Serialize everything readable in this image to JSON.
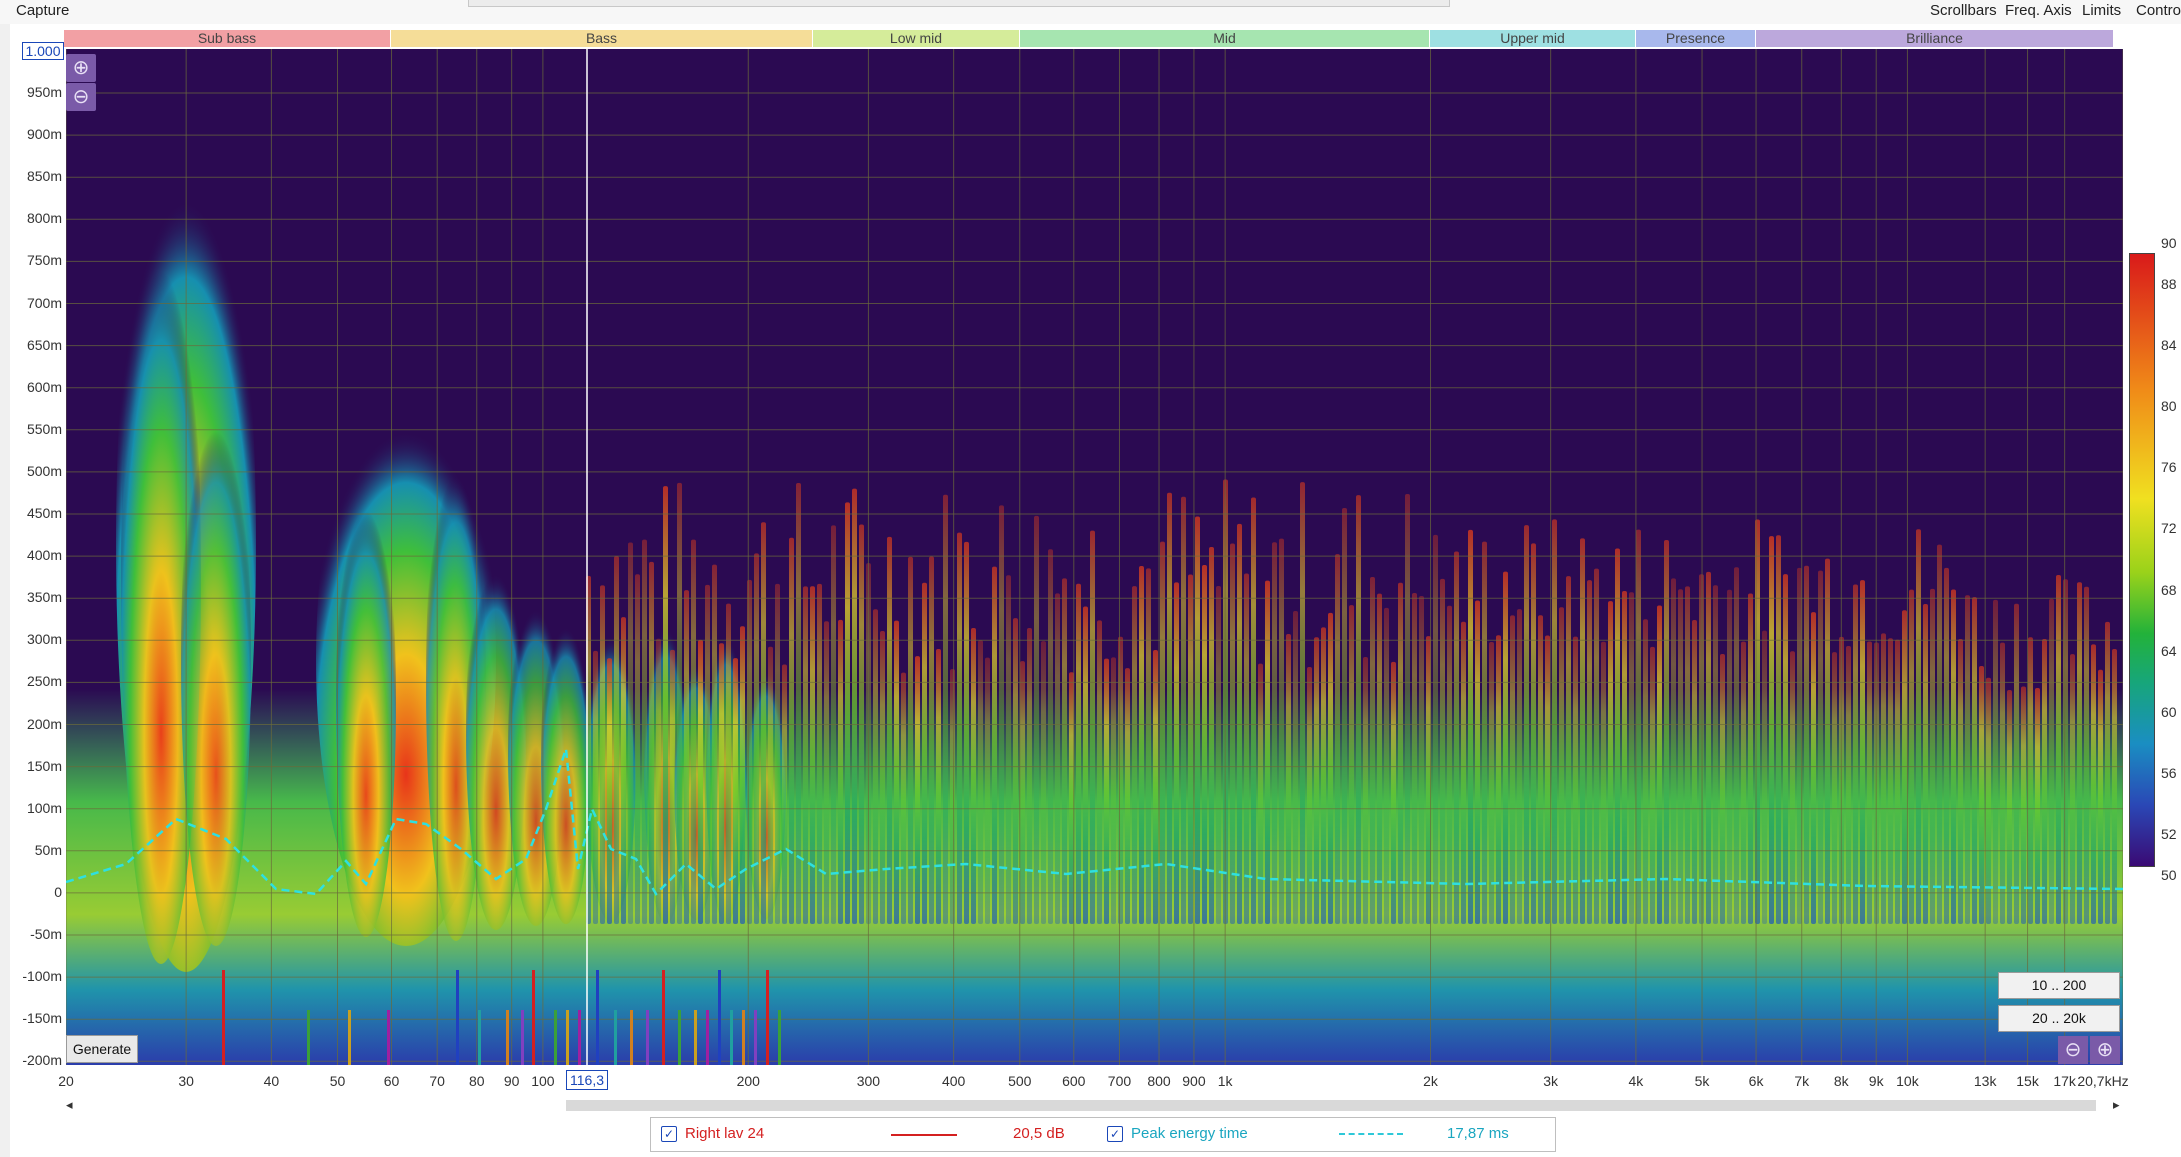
{
  "toolbar": {
    "title": "Capture",
    "links": [
      "Scrollbars",
      "Freq. Axis",
      "Limits",
      "Contro"
    ]
  },
  "bands": [
    {
      "label": "Sub bass",
      "color": "#f2a0a4"
    },
    {
      "label": "Bass",
      "color": "#f5dd98"
    },
    {
      "label": "Low mid",
      "color": "#d5ec9a"
    },
    {
      "label": "Mid",
      "color": "#a6e5b0"
    },
    {
      "label": "Upper mid",
      "color": "#9ee0e2"
    },
    {
      "label": "Presence",
      "color": "#a8b8ec"
    },
    {
      "label": "Brilliance",
      "color": "#bca8dc"
    }
  ],
  "y_axis": {
    "max_value": "1.000",
    "labels": [
      "950m",
      "900m",
      "850m",
      "800m",
      "750m",
      "700m",
      "650m",
      "600m",
      "550m",
      "500m",
      "450m",
      "400m",
      "350m",
      "300m",
      "250m",
      "200m",
      "150m",
      "100m",
      "50m",
      "0",
      "-50m",
      "-100m",
      "-150m",
      "-200m"
    ]
  },
  "x_axis": {
    "labels": [
      "20",
      "30",
      "40",
      "50",
      "60",
      "70",
      "80",
      "90",
      "100",
      "200",
      "300",
      "400",
      "500",
      "600",
      "700",
      "800",
      "900",
      "1k",
      "2k",
      "3k",
      "4k",
      "5k",
      "6k",
      "7k",
      "8k",
      "9k",
      "10k",
      "13k",
      "15k",
      "17k",
      "20,7kHz"
    ],
    "cursor_value": "116,3"
  },
  "color_scale": {
    "labels": [
      "90",
      "88",
      "84",
      "80",
      "76",
      "72",
      "68",
      "64",
      "60",
      "56",
      "52",
      "50"
    ]
  },
  "buttons": {
    "generate": "Generate",
    "range_low": "10 .. 200",
    "range_full": "20 .. 20k",
    "zoom_in": "⊕",
    "zoom_out": "⊖",
    "scroll_left": "◂",
    "scroll_right": "▸"
  },
  "legend": {
    "items": [
      {
        "label": "Right lav 24",
        "value": "20,5 dB",
        "color": "#d42020",
        "checked": true,
        "check": "✓"
      },
      {
        "label": "Peak energy time",
        "value": "17,87 ms",
        "color": "#2ec8d8",
        "checked": true,
        "check": "✓"
      }
    ]
  },
  "colors": {
    "background": "#2b0a52",
    "grid": "#6b6b3a",
    "cursor": "#ffffff",
    "peak_line": "#2ee0e0"
  }
}
